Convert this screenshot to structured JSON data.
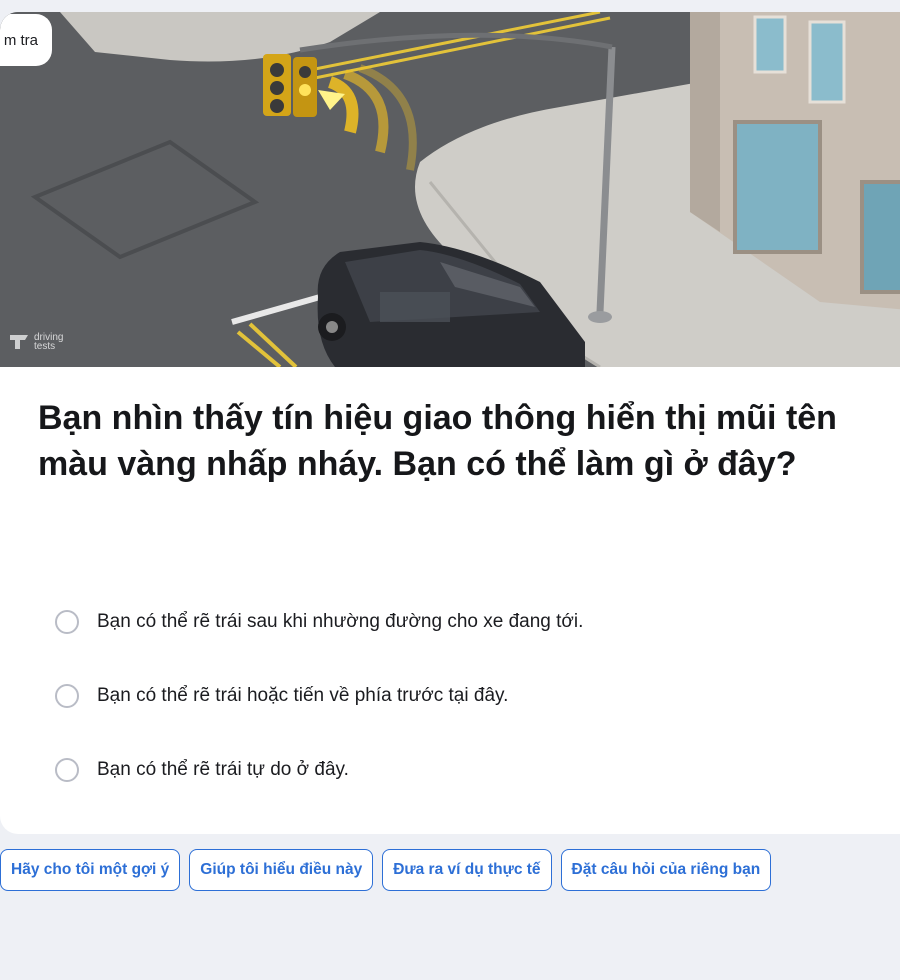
{
  "hero": {
    "tag_label": "m tra",
    "watermark_text": "driving tests"
  },
  "question": {
    "text": "Bạn nhìn thấy tín hiệu giao thông hiển thị mũi tên màu vàng nhấp nháy. Bạn có thể làm gì ở đây?"
  },
  "options": [
    {
      "label": "Bạn có thể rẽ trái sau khi nhường đường cho xe đang tới."
    },
    {
      "label": "Bạn có thể rẽ trái hoặc tiến về phía trước tại đây."
    },
    {
      "label": "Bạn có thể rẽ trái tự do ở đây."
    }
  ],
  "chips": [
    {
      "label": "Hãy cho tôi một gợi ý"
    },
    {
      "label": "Giúp tôi hiểu điều này"
    },
    {
      "label": "Đưa ra ví dụ thực tế"
    },
    {
      "label": "Đặt câu hỏi của riêng bạn"
    }
  ],
  "colors": {
    "accent": "#2d6fd6",
    "signal_yellow": "#f3c21f",
    "background": "#eef0f5"
  }
}
